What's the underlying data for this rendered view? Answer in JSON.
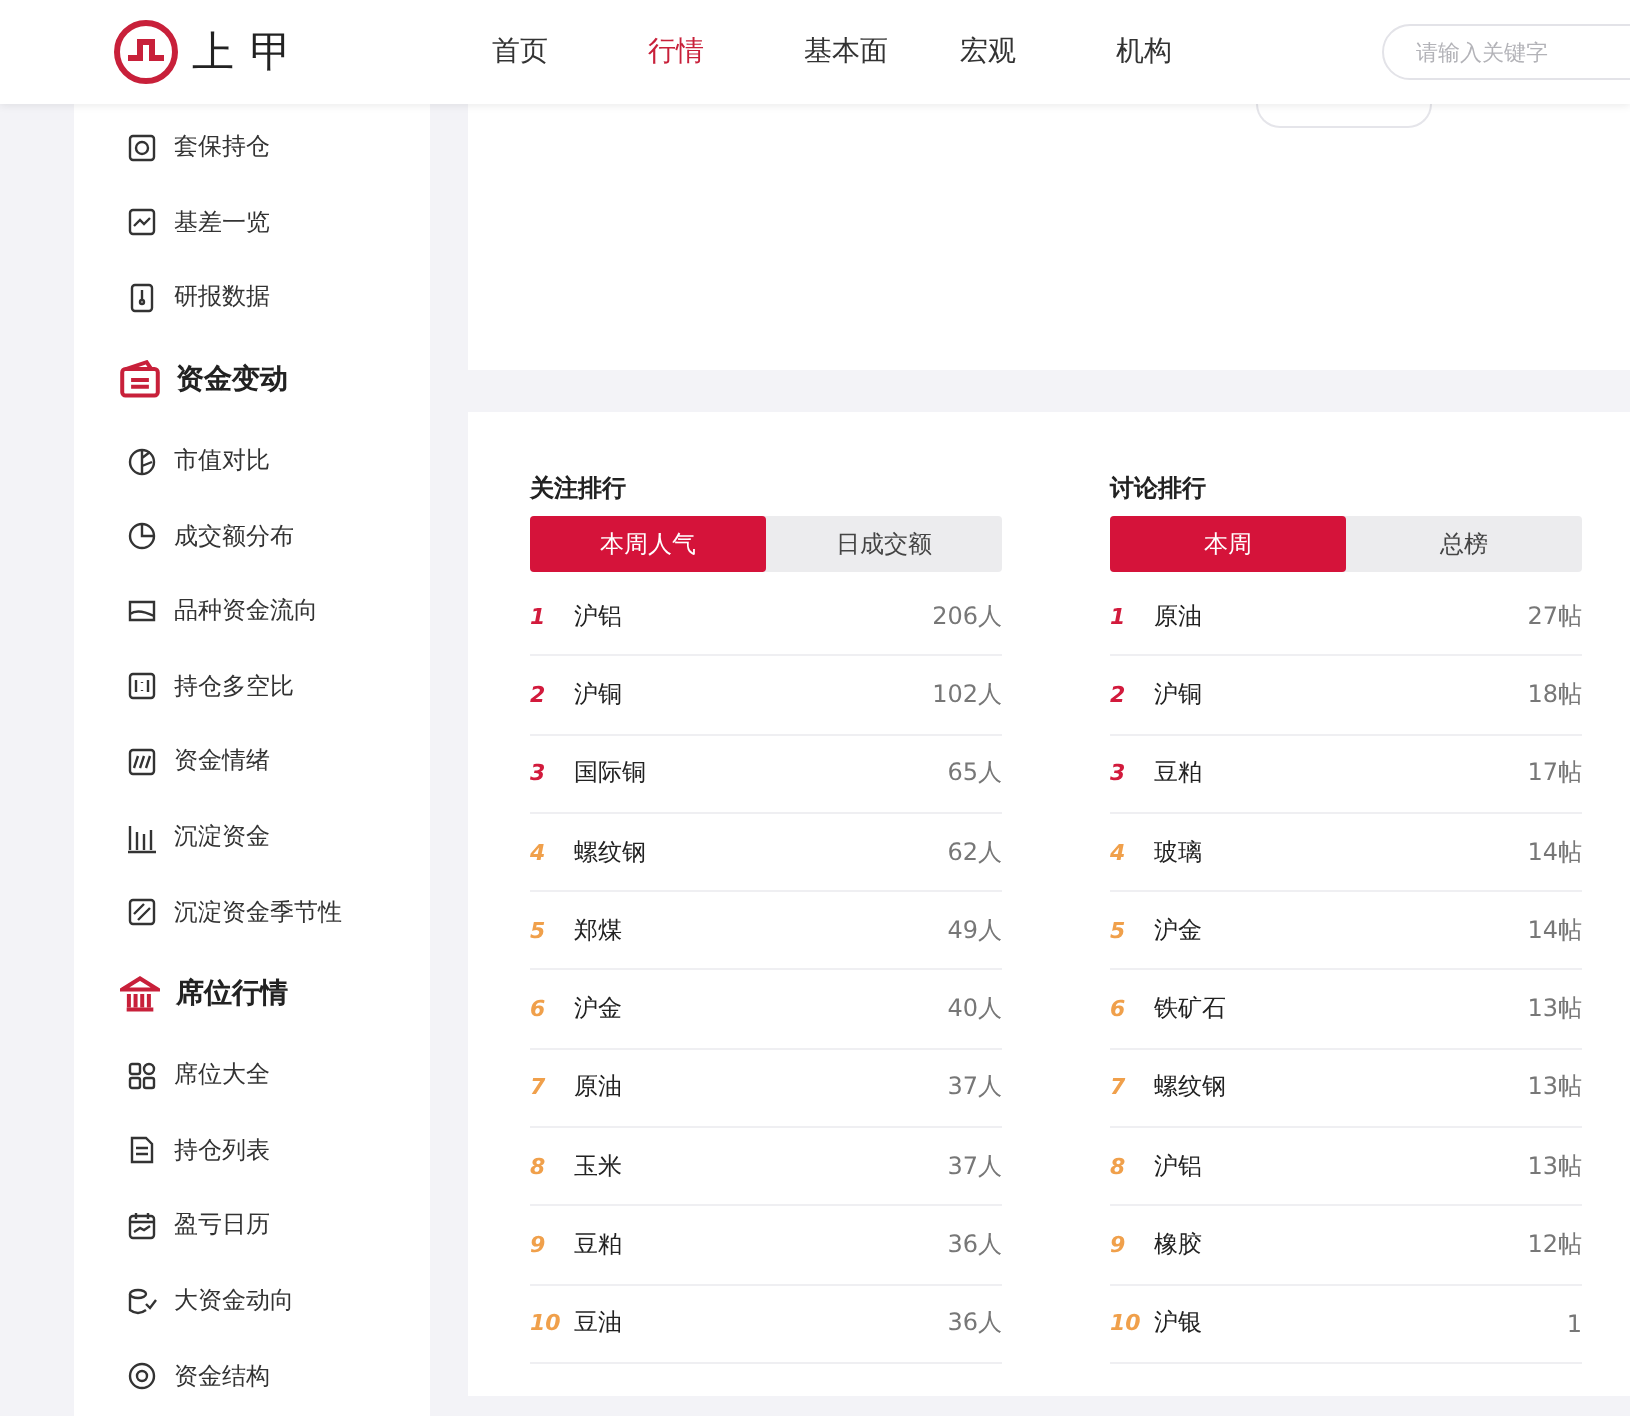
{
  "header": {
    "logo_text": "上甲",
    "nav": [
      {
        "label": "首页",
        "selected": false
      },
      {
        "label": "行情",
        "selected": true
      },
      {
        "label": "基本面",
        "selected": false
      },
      {
        "label": "宏观",
        "selected": false
      },
      {
        "label": "机构",
        "selected": false
      }
    ],
    "search": {
      "placeholder": "请输入关键字"
    }
  },
  "sidebar": {
    "items": [
      {
        "kind": "item",
        "label": "套保持仓"
      },
      {
        "kind": "item",
        "label": "基差一览"
      },
      {
        "kind": "item",
        "label": "研报数据"
      },
      {
        "kind": "section",
        "label": "资金变动"
      },
      {
        "kind": "item",
        "label": "市值对比"
      },
      {
        "kind": "item",
        "label": "成交额分布"
      },
      {
        "kind": "item",
        "label": "品种资金流向"
      },
      {
        "kind": "item",
        "label": "持仓多空比"
      },
      {
        "kind": "item",
        "label": "资金情绪"
      },
      {
        "kind": "item",
        "label": "沉淀资金"
      },
      {
        "kind": "item",
        "label": "沉淀资金季节性"
      },
      {
        "kind": "section",
        "label": "席位行情"
      },
      {
        "kind": "item",
        "label": "席位大全"
      },
      {
        "kind": "item",
        "label": "持仓列表"
      },
      {
        "kind": "item",
        "label": "盈亏日历"
      },
      {
        "kind": "item",
        "label": "大资金动向"
      },
      {
        "kind": "item",
        "label": "资金结构"
      }
    ]
  },
  "rankings": [
    {
      "title": "关注排行",
      "tabs": [
        {
          "label": "本周人气",
          "selected": true
        },
        {
          "label": "日成交额",
          "selected": false
        }
      ],
      "rows": [
        {
          "rank": "1",
          "name": "沪铝",
          "value": "206人",
          "color": "#d21a3c"
        },
        {
          "rank": "2",
          "name": "沪铜",
          "value": "102人",
          "color": "#d21a3c"
        },
        {
          "rank": "3",
          "name": "国际铜",
          "value": "65人",
          "color": "#d21a3c"
        },
        {
          "rank": "4",
          "name": "螺纹钢",
          "value": "62人",
          "color": "#f0a04b"
        },
        {
          "rank": "5",
          "name": "郑煤",
          "value": "49人",
          "color": "#f0a04b"
        },
        {
          "rank": "6",
          "name": "沪金",
          "value": "40人",
          "color": "#f0a04b"
        },
        {
          "rank": "7",
          "name": "原油",
          "value": "37人",
          "color": "#f0a04b"
        },
        {
          "rank": "8",
          "name": "玉米",
          "value": "37人",
          "color": "#f0a04b"
        },
        {
          "rank": "9",
          "name": "豆粕",
          "value": "36人",
          "color": "#f0a04b"
        },
        {
          "rank": "10",
          "name": "豆油",
          "value": "36人",
          "color": "#f0a04b"
        }
      ]
    },
    {
      "title": "讨论排行",
      "tabs": [
        {
          "label": "本周",
          "selected": true
        },
        {
          "label": "总榜",
          "selected": false
        }
      ],
      "rows": [
        {
          "rank": "1",
          "name": "原油",
          "value": "27帖",
          "color": "#d21a3c"
        },
        {
          "rank": "2",
          "name": "沪铜",
          "value": "18帖",
          "color": "#d21a3c"
        },
        {
          "rank": "3",
          "name": "豆粕",
          "value": "17帖",
          "color": "#d21a3c"
        },
        {
          "rank": "4",
          "name": "玻璃",
          "value": "14帖",
          "color": "#f0a04b"
        },
        {
          "rank": "5",
          "name": "沪金",
          "value": "14帖",
          "color": "#f0a04b"
        },
        {
          "rank": "6",
          "name": "铁矿石",
          "value": "13帖",
          "color": "#f0a04b"
        },
        {
          "rank": "7",
          "name": "螺纹钢",
          "value": "13帖",
          "color": "#f0a04b"
        },
        {
          "rank": "8",
          "name": "沪铝",
          "value": "13帖",
          "color": "#f0a04b"
        },
        {
          "rank": "9",
          "name": "橡胶",
          "value": "12帖",
          "color": "#f0a04b"
        },
        {
          "rank": "10",
          "name": "沪银",
          "value": "1",
          "color": "#f0a04b"
        }
      ]
    }
  ]
}
